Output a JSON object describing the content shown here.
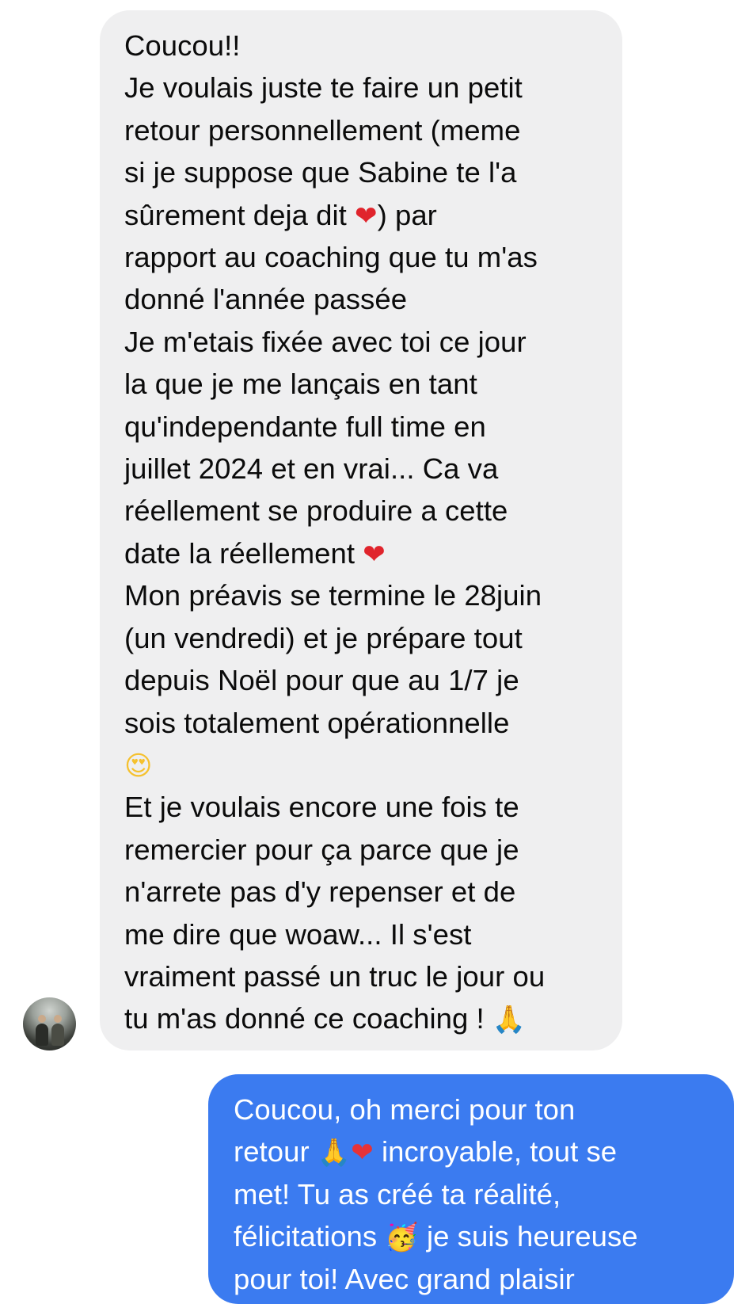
{
  "conversation": {
    "incoming": {
      "lines": [
        "Coucou!!",
        "Je voulais juste te faire un petit",
        "retour personnellement (meme",
        "si je suppose que Sabine te l'a",
        {
          "before": "sûrement deja dit ",
          "emoji": "❤",
          "after": ") par"
        },
        "rapport au coaching que tu m'as",
        "donné l'année passée",
        "Je m'etais fixée avec toi ce jour",
        "la que je me lançais en tant",
        "qu'independante full time en",
        "juillet 2024 et en vrai... Ca va",
        "réellement se produire a cette",
        {
          "before": "date la réellement ",
          "emoji": "❤",
          "after": ""
        },
        "Mon préavis se termine le 28juin",
        "(un vendredi) et je prépare tout",
        "depuis Noël pour que au 1/7 je",
        "sois totalement opérationnelle",
        {
          "before": "",
          "emoji": "😍",
          "after": ""
        },
        "Et je voulais encore une fois te",
        "remercier pour ça parce que je",
        "n'arrete pas d'y repenser et de",
        "me dire que woaw... Il s'est",
        "vraiment passé un truc le jour ou",
        {
          "before": "tu m'as donné ce coaching ! ",
          "emoji": "🙏",
          "after": ""
        }
      ]
    },
    "outgoing": {
      "lines": [
        "Coucou, oh merci pour ton",
        {
          "before": "retour ",
          "emoji": "🙏❤",
          "after": " incroyable, tout se"
        },
        "met! Tu as créé ta réalité,",
        {
          "before": "félicitations ",
          "emoji": "🥳",
          "after": " je suis heureuse"
        },
        "pour toi! Avec grand plaisir"
      ]
    }
  },
  "colors": {
    "incoming_bubble": "#efeff0",
    "outgoing_bubble": "#3b7bf0",
    "incoming_text": "#0b0b0b",
    "outgoing_text": "#ffffff"
  }
}
